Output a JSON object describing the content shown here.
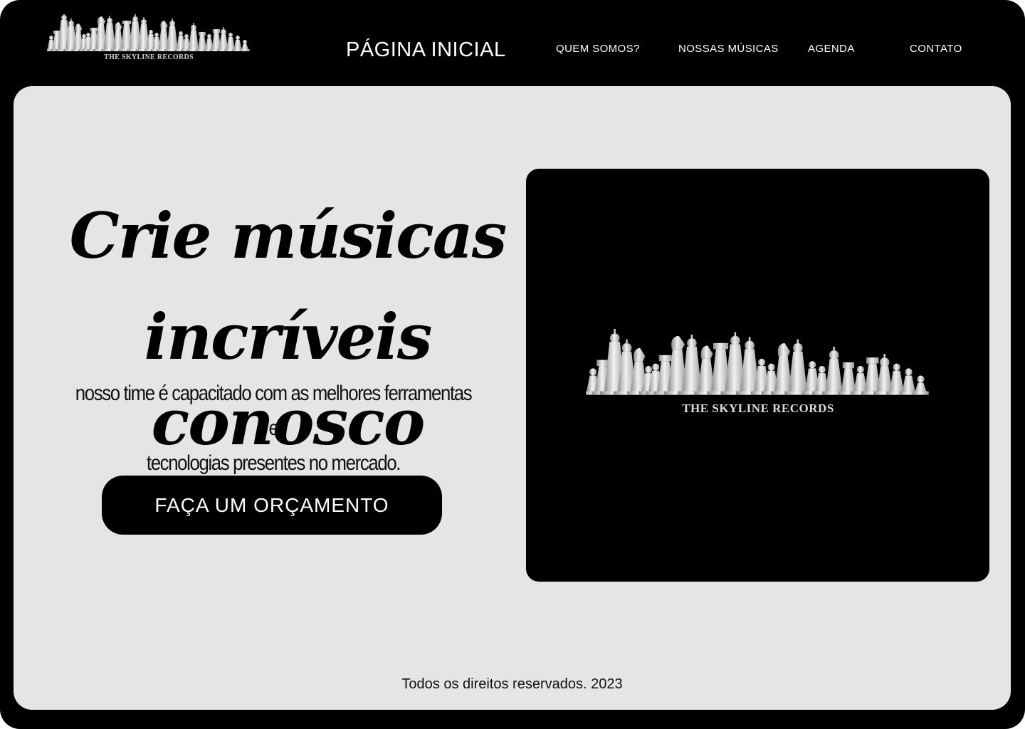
{
  "brand": {
    "name": "THE SKYLINE RECORDS",
    "logo_icon": "chess-pieces-logo"
  },
  "nav": {
    "home": "PÁGINA INICIAL",
    "items": [
      {
        "label": "QUEM SOMOS?"
      },
      {
        "label": "NOSSAS MÚSICAS"
      },
      {
        "label": "AGENDA"
      },
      {
        "label": "CONTATO"
      }
    ]
  },
  "hero": {
    "title_line1": "Crie músicas",
    "title_line2": "incríveis  conosco",
    "subtitle_line1": "nosso time é capacitado com as melhores ferramentas e",
    "subtitle_line2": "tecnologias presentes no mercado.",
    "cta_label": "FAÇA UM ORÇAMENTO"
  },
  "footer": {
    "text": "Todos os direitos reservados. 2023"
  },
  "colors": {
    "frame": "#000000",
    "panel": "#e5e5e5",
    "text_light": "#ffffff",
    "text_dark": "#000000"
  }
}
